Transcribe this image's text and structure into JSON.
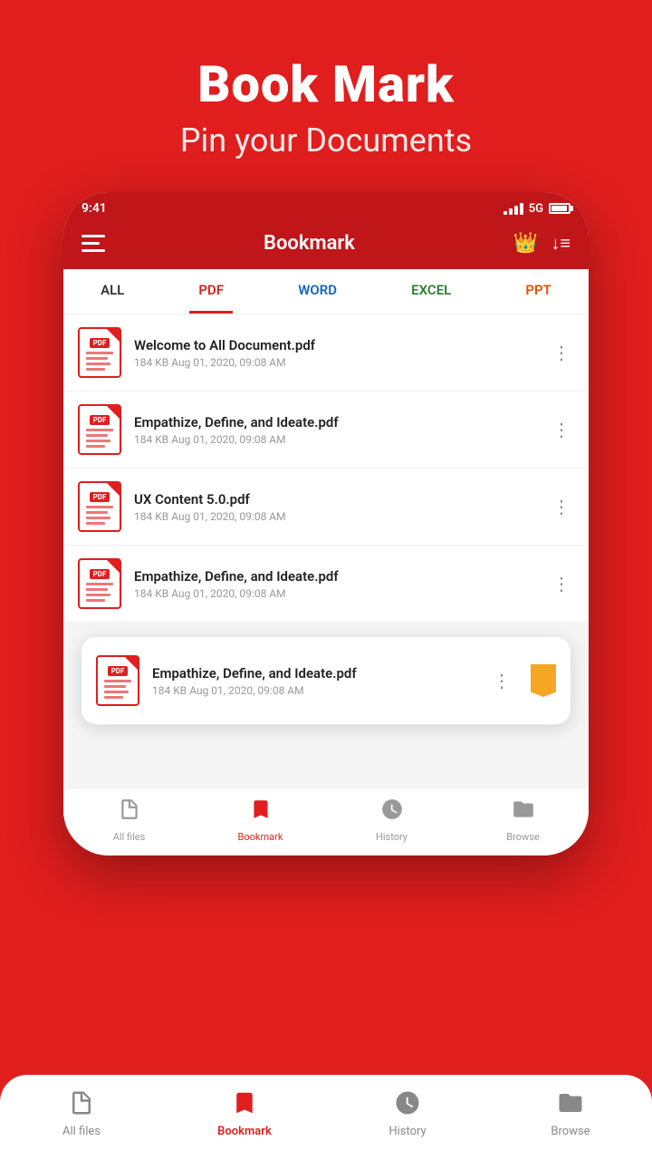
{
  "hero": {
    "title": "Book Mark",
    "subtitle": "Pin your Documents"
  },
  "status_bar": {
    "time": "9:41",
    "network": "5G"
  },
  "app_header": {
    "title": "Bookmark"
  },
  "filter_tabs": [
    {
      "id": "all",
      "label": "ALL",
      "state": "normal"
    },
    {
      "id": "pdf",
      "label": "PDF",
      "state": "active"
    },
    {
      "id": "word",
      "label": "WORD",
      "state": "normal"
    },
    {
      "id": "excel",
      "label": "EXCEL",
      "state": "normal"
    },
    {
      "id": "ppt",
      "label": "PPT",
      "state": "normal"
    }
  ],
  "files": [
    {
      "name": "Welcome to All Document.pdf",
      "meta": "184 KB  Aug 01, 2020, 09:08 AM"
    },
    {
      "name": "Empathize, Define, and Ideate.pdf",
      "meta": "184 KB  Aug 01, 2020, 09:08 AM"
    },
    {
      "name": "UX Content 5.0.pdf",
      "meta": "184 KB  Aug 01, 2020, 09:08 AM"
    },
    {
      "name": "Empathize, Define, and Ideate.pdf",
      "meta": "184 KB  Aug 01, 2020, 09:08 AM"
    }
  ],
  "popup": {
    "name": "Empathize, Define, and Ideate.pdf",
    "meta": "184 KB  Aug 01, 2020, 09:08 AM"
  },
  "bottom_nav": [
    {
      "id": "all-files",
      "label": "All files",
      "active": false
    },
    {
      "id": "bookmark",
      "label": "Bookmark",
      "active": true
    },
    {
      "id": "history",
      "label": "History",
      "active": false
    },
    {
      "id": "browse",
      "label": "Browse",
      "active": false
    }
  ]
}
